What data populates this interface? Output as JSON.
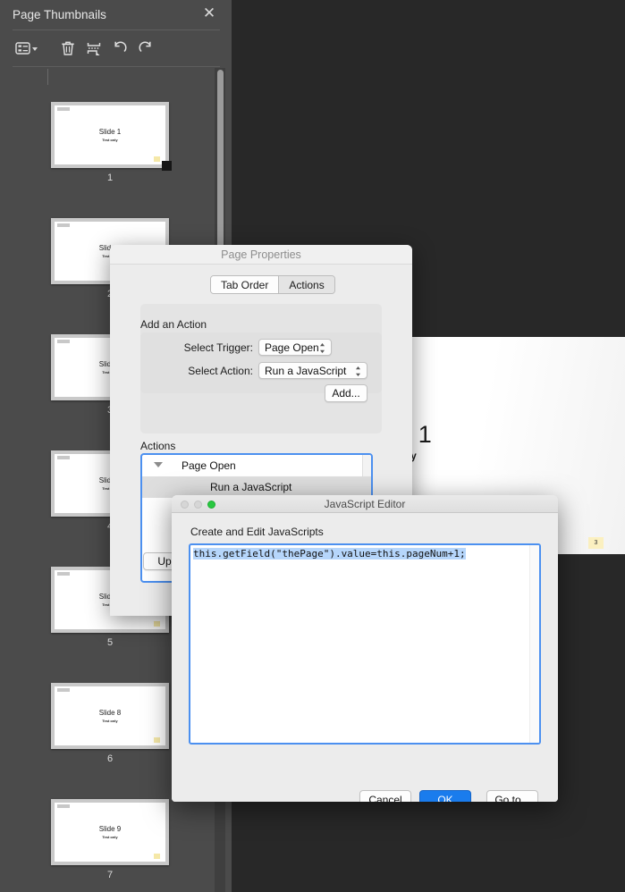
{
  "document_view": {
    "page": {
      "title": "Slide 1",
      "subtitle": "Test only",
      "field_value": "3"
    }
  },
  "thumbnail_panel": {
    "title": "Page Thumbnails",
    "close_icon": "close-icon",
    "toolbar": [
      {
        "name": "page-display-options-icon",
        "label": "list-options-icon"
      },
      {
        "name": "delete-pages-icon",
        "label": "trash-icon"
      },
      {
        "name": "extract-pages-icon",
        "label": "extract-pages-icon"
      },
      {
        "name": "rotate-counterclockwise-icon",
        "label": "rotate-ccw-icon"
      },
      {
        "name": "rotate-clockwise-icon",
        "label": "rotate-cw-icon"
      }
    ],
    "thumbnails": [
      {
        "number": "1",
        "title": "Slide 1",
        "subtitle": "Test only",
        "selected": true
      },
      {
        "number": "2",
        "title": "Slide 2",
        "subtitle": "Test only",
        "selected": false
      },
      {
        "number": "3",
        "title": "Slide 3",
        "subtitle": "Test only",
        "selected": false
      },
      {
        "number": "4",
        "title": "Slide 4",
        "subtitle": "Test only",
        "selected": false
      },
      {
        "number": "5",
        "title": "Slide 5",
        "subtitle": "Test only",
        "selected": false
      },
      {
        "number": "6",
        "title": "Slide 8",
        "subtitle": "Test only",
        "selected": false
      },
      {
        "number": "7",
        "title": "Slide 9",
        "subtitle": "Test only",
        "selected": false
      }
    ]
  },
  "page_properties": {
    "title": "Page Properties",
    "tabs": [
      {
        "label": "Tab Order",
        "active": false
      },
      {
        "label": "Actions",
        "active": true
      }
    ],
    "add_an_action_label": "Add an Action",
    "select_trigger_label": "Select Trigger:",
    "select_trigger_value": "Page Open",
    "select_action_label": "Select Action:",
    "select_action_value": "Run a JavaScript",
    "add_button": "Add...",
    "actions_label": "Actions",
    "action_tree": [
      {
        "label": "Page Open",
        "level": "root"
      },
      {
        "label": "Run a JavaScript",
        "level": "child"
      }
    ],
    "up_button": "Up"
  },
  "javascript_editor": {
    "title": "JavaScript Editor",
    "caption": "Create and Edit JavaScripts",
    "code": "this.getField(\"thePage\").value=this.pageNum+1;",
    "buttons": {
      "cancel": "Cancel",
      "ok": "OK",
      "goto": "Go to..."
    }
  },
  "colors": {
    "accent_blue": "#1a7ced",
    "selection_blue": "#b6d6fb",
    "focus_ring": "#4c90f0",
    "panel_bg": "#4b4b4b",
    "doc_bg": "#282828",
    "field_yellow": "#fbf0c0",
    "traffic_green": "#28c840"
  }
}
